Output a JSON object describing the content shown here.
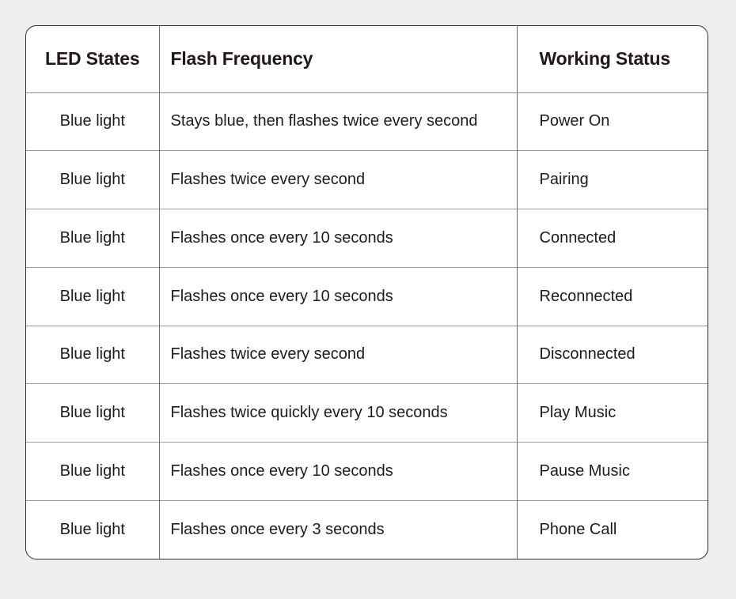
{
  "table": {
    "columns": [
      {
        "key": "led_state",
        "label": "LED States"
      },
      {
        "key": "flash_frequency",
        "label": "Flash Frequency"
      },
      {
        "key": "working_status",
        "label": "Working Status"
      }
    ],
    "rows": [
      {
        "led_state": "Blue light",
        "flash_frequency": "Stays blue, then flashes twice every second",
        "working_status": "Power On"
      },
      {
        "led_state": "Blue light",
        "flash_frequency": "Flashes twice every second",
        "working_status": "Pairing"
      },
      {
        "led_state": "Blue light",
        "flash_frequency": "Flashes once every 10 seconds",
        "working_status": "Connected"
      },
      {
        "led_state": "Blue light",
        "flash_frequency": "Flashes once every 10 seconds",
        "working_status": "Reconnected"
      },
      {
        "led_state": "Blue light",
        "flash_frequency": "Flashes twice every second",
        "working_status": "Disconnected"
      },
      {
        "led_state": "Blue light",
        "flash_frequency": "Flashes twice quickly every 10 seconds",
        "working_status": "Play Music"
      },
      {
        "led_state": "Blue light",
        "flash_frequency": "Flashes once every 10 seconds",
        "working_status": "Pause Music"
      },
      {
        "led_state": "Blue light",
        "flash_frequency": "Flashes once every 3 seconds",
        "working_status": "Phone Call"
      }
    ]
  },
  "colors": {
    "page_background": "#f0efee",
    "card_background": "#ffffff",
    "card_border": "#2b2b2b",
    "header_text": "#231815",
    "body_text": "#1c1c1c",
    "row_divider": "#9a9a9a",
    "column_divider": "#6f6f6f"
  }
}
